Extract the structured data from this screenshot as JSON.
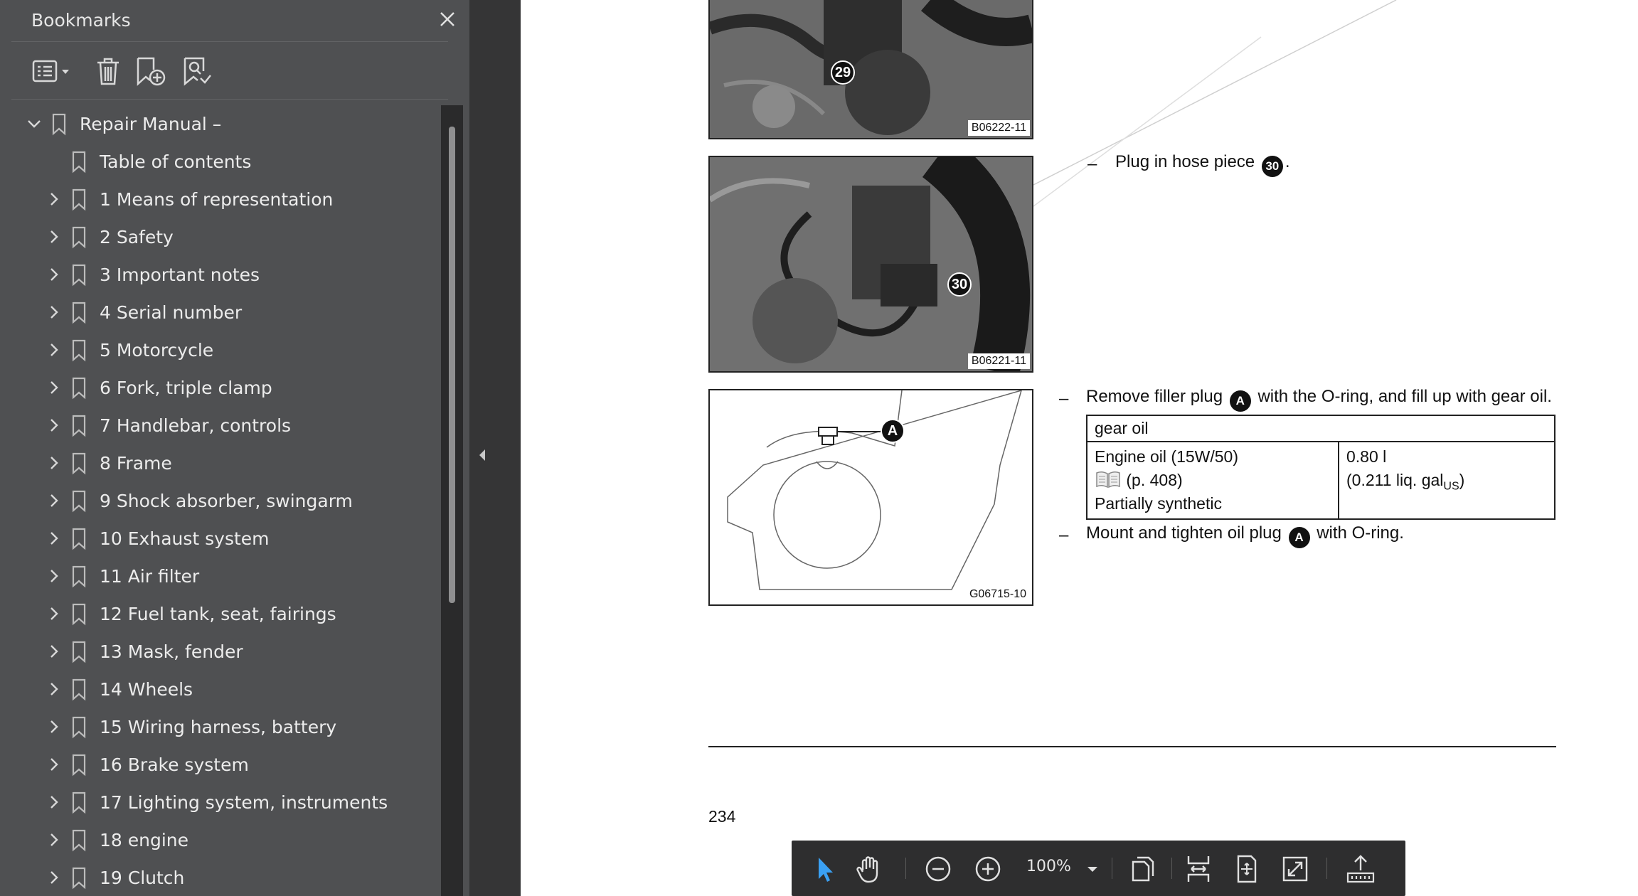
{
  "sidebar": {
    "title": "Bookmarks",
    "tree": [
      {
        "label": "Repair Manual –",
        "expanded": true,
        "level": 0
      },
      {
        "label": "Table of contents",
        "level": 1,
        "children": false
      },
      {
        "label": "1 Means of representation",
        "level": 1
      },
      {
        "label": "2 Safety",
        "level": 1
      },
      {
        "label": "3 Important notes",
        "level": 1
      },
      {
        "label": "4 Serial number",
        "level": 1
      },
      {
        "label": "5 Motorcycle",
        "level": 1
      },
      {
        "label": "6 Fork, triple clamp",
        "level": 1
      },
      {
        "label": "7 Handlebar, controls",
        "level": 1
      },
      {
        "label": "8 Frame",
        "level": 1
      },
      {
        "label": "9 Shock absorber, swingarm",
        "level": 1
      },
      {
        "label": "10 Exhaust system",
        "level": 1
      },
      {
        "label": "11 Air filter",
        "level": 1
      },
      {
        "label": "12 Fuel tank, seat, fairings",
        "level": 1
      },
      {
        "label": "13 Mask, fender",
        "level": 1
      },
      {
        "label": "14 Wheels",
        "level": 1
      },
      {
        "label": "15 Wiring harness, battery",
        "level": 1
      },
      {
        "label": "16 Brake system",
        "level": 1
      },
      {
        "label": "17 Lighting system, instruments",
        "level": 1
      },
      {
        "label": "18 engine",
        "level": 1
      },
      {
        "label": "19 Clutch",
        "level": 1
      }
    ]
  },
  "page": {
    "images": [
      {
        "code": "B06222-11",
        "callout": "29"
      },
      {
        "code": "B06221-11",
        "callout": "30"
      },
      {
        "code": "G06715-10",
        "callout": "A"
      }
    ],
    "step1": {
      "dash": "–",
      "text_before": "Plug in hose piece",
      "badge": "30",
      "text_after": "."
    },
    "step2": {
      "dash": "–",
      "text_before": "Remove filler plug",
      "badge": "A",
      "text_after": "with the O-ring, and fill up with gear oil."
    },
    "table": {
      "header": "gear oil",
      "left_line1": "Engine oil (15W/50)",
      "left_ref": "(p. 408)",
      "left_line3": "Partially synthetic",
      "right_line1": "0.80 l",
      "right_line2_pre": "(0.211 liq. gal",
      "right_sub": "US",
      "right_line2_post": ")"
    },
    "step3": {
      "dash": "–",
      "text_before": "Mount and tighten oil plug",
      "badge": "A",
      "text_after": "with O-ring."
    },
    "page_number": "234"
  },
  "toolbar": {
    "zoom": "100%"
  },
  "colors": {
    "sidebar_bg": "#4f5052",
    "gutter_bg": "#353536",
    "toolbar_bg": "#2e2e2f",
    "select_tool_accent": "#3aa0f3"
  }
}
